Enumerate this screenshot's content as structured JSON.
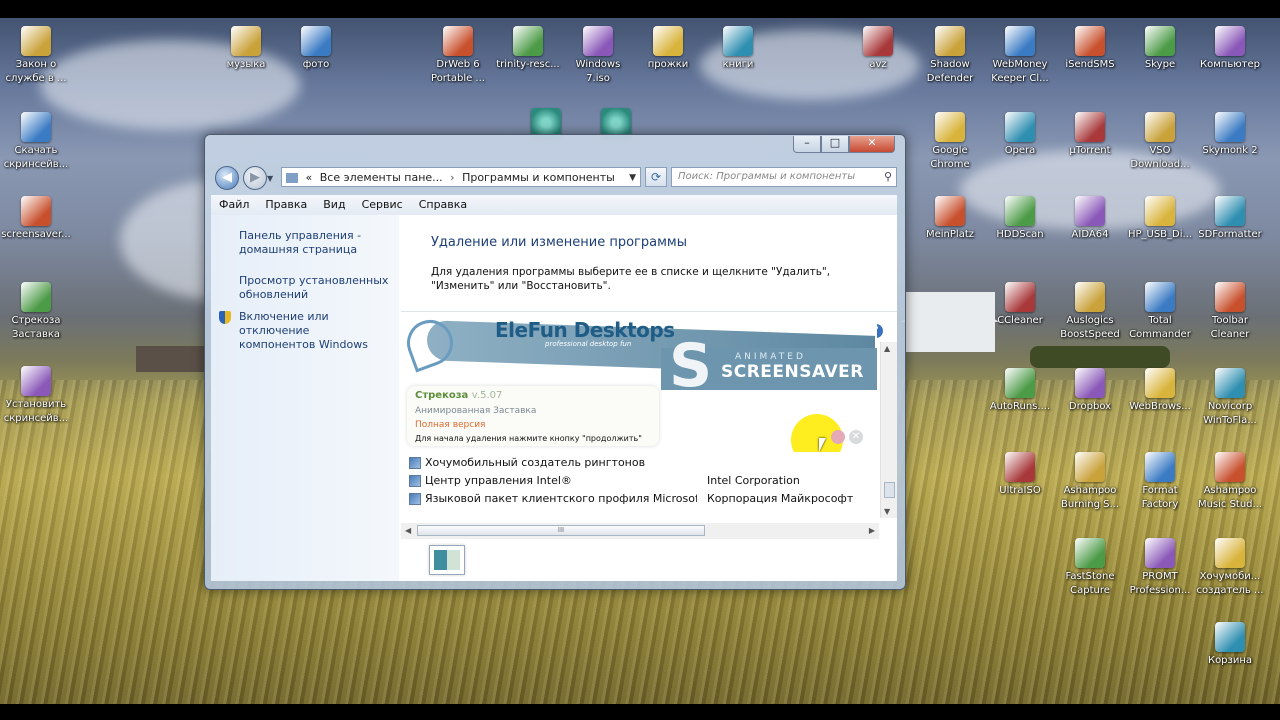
{
  "colors": {
    "link": "#1e3f76",
    "accent_yellow": "#ffec00",
    "version_green": "#5c8f3a",
    "full_orange": "#e06a2d"
  },
  "desktop": {
    "left_icons": [
      {
        "label": "Закон о\nслужбе в ...",
        "icon": "word-doc-icon"
      },
      {
        "label": "Скачать\nскринсейв...",
        "icon": "film-icon"
      },
      {
        "label": "screensaver...",
        "icon": "file-icon"
      },
      {
        "label": "Стрекоза\nЗаставка",
        "icon": "screensaver-icon"
      },
      {
        "label": "Установить\nскринсейв...",
        "icon": "film-icon"
      }
    ],
    "top_icons": [
      {
        "label": "музыка",
        "icon": "folder-music-icon"
      },
      {
        "label": "фото",
        "icon": "folder-photo-icon"
      },
      {
        "label": "DrWeb 6\nPortable ...",
        "icon": "archive-icon"
      },
      {
        "label": "trinity-resc...",
        "icon": "disc-icon"
      },
      {
        "label": "Windows\n7.iso",
        "icon": "disc-icon"
      },
      {
        "label": "прожки",
        "icon": "folder-icon"
      },
      {
        "label": "книги",
        "icon": "folder-icon"
      },
      {
        "label": "avz",
        "icon": "avz-icon"
      }
    ],
    "right_icons": [
      {
        "label": "Shadow\nDefender",
        "icon": "shield-app-icon"
      },
      {
        "label": "WebMoney\nKeeper Cl...",
        "icon": "webmoney-icon"
      },
      {
        "label": "iSendSMS",
        "icon": "sms-icon"
      },
      {
        "label": "Skype",
        "icon": "skype-icon"
      },
      {
        "label": "Компьютер",
        "icon": "computer-icon"
      },
      {
        "label": "Google\nChrome",
        "icon": "chrome-icon"
      },
      {
        "label": "Opera",
        "icon": "opera-icon"
      },
      {
        "label": "µTorrent",
        "icon": "utorrent-icon"
      },
      {
        "label": "VSO\nDownload...",
        "icon": "vso-icon"
      },
      {
        "label": "Skymonk 2",
        "icon": "skymonk-icon"
      },
      {
        "label": "MeinPlatz",
        "icon": "chart-app-icon"
      },
      {
        "label": "HDDScan",
        "icon": "hdd-icon"
      },
      {
        "label": "AIDA64",
        "icon": "aida-icon"
      },
      {
        "label": "HP_USB_Di...",
        "icon": "usb-icon"
      },
      {
        "label": "SDFormatter",
        "icon": "sd-icon"
      },
      {
        "label": "CCleaner",
        "icon": "ccleaner-icon"
      },
      {
        "label": "Auslogics\nBoostSpeed",
        "icon": "boost-icon"
      },
      {
        "label": "Total\nCommander",
        "icon": "floppy-icon"
      },
      {
        "label": "Toolbar\nCleaner",
        "icon": "cleaner-icon"
      },
      {
        "label": "AutoRuns....",
        "icon": "autoruns-icon"
      },
      {
        "label": "Dropbox",
        "icon": "dropbox-icon"
      },
      {
        "label": "WebBrows...",
        "icon": "folder-icon"
      },
      {
        "label": "Novicorp\nWinToFla...",
        "icon": "folder-icon"
      },
      {
        "label": "UltraISO",
        "icon": "ultraiso-icon"
      },
      {
        "label": "Ashampoo\nBurning S...",
        "icon": "ashampoo-icon"
      },
      {
        "label": "Format\nFactory",
        "icon": "format-icon"
      },
      {
        "label": "Ashampoo\nMusic Stud...",
        "icon": "ashampoo-icon"
      },
      {
        "label": "FastStone\nCapture",
        "icon": "faststone-icon"
      },
      {
        "label": "PROMT\nProfession...",
        "icon": "promt-icon"
      },
      {
        "label": "Хочумоби...\nсоздатель ...",
        "icon": "phone-icon"
      },
      {
        "label": "Корзина",
        "icon": "recycle-bin-icon"
      }
    ]
  },
  "window": {
    "address": {
      "chevrons": "«",
      "part1": "Все элементы пане...",
      "sep": "›",
      "part2": "Программы и компоненты"
    },
    "search_placeholder": "Поиск: Программы и компоненты",
    "menu": [
      "Файл",
      "Правка",
      "Вид",
      "Сервис",
      "Справка"
    ],
    "sidebar": {
      "home": "Панель управления -\nдомашняя страница",
      "updates": "Просмотр установленных\nобновлений",
      "features": "Включение или отключение\nкомпонентов Windows"
    },
    "heading": "Удаление или изменение программы",
    "description": "Для удаления программы выберите ее в списке и щелкните \"Удалить\", \"Изменить\" или \"Восстановить\".",
    "banner": {
      "brand": "EleFun Desktops",
      "brand_sub": "professional desktop fun",
      "animated": "ANIMATED",
      "screensaver": "SCREENSAVER",
      "app_name": "Стрекоза",
      "version": "v.5.07",
      "subtitle": "Анимированная Заставка",
      "edition": "Полная версия",
      "instruction": "Для начала удаления нажмите кнопку \"продолжить\""
    },
    "programs": [
      {
        "name": "Хочумобильный создатель рингтонов",
        "publisher": ""
      },
      {
        "name": "Центр управления Intel®",
        "publisher": "Intel Corporation"
      },
      {
        "name": "Языковой пакет клиентского профиля Microsoft.N...",
        "publisher": "Корпорация Майкрософт"
      }
    ]
  }
}
